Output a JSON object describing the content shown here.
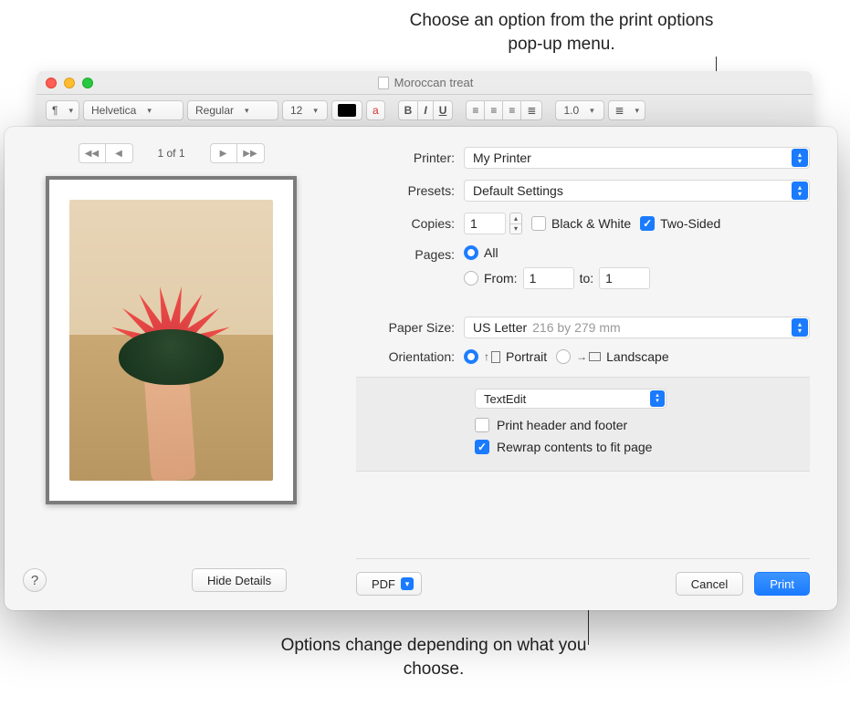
{
  "callouts": {
    "top": "Choose an option from the print options pop-up menu.",
    "bottom": "Options change depending on what you choose."
  },
  "editor": {
    "document_title": "Moroccan treat",
    "toolbar": {
      "paragraph": "¶",
      "font_family": "Helvetica",
      "font_style": "Regular",
      "font_size": "12",
      "color_icon": "a",
      "bold": "B",
      "italic": "I",
      "underline": "U",
      "line_spacing": "1.0"
    }
  },
  "print": {
    "pager": {
      "label": "1 of 1"
    },
    "printer": {
      "label": "Printer:",
      "value": "My Printer"
    },
    "presets": {
      "label": "Presets:",
      "value": "Default Settings"
    },
    "copies": {
      "label": "Copies:",
      "value": "1",
      "bw_label": "Black & White",
      "bw_on": false,
      "twosided_label": "Two-Sided",
      "twosided_on": true
    },
    "pages": {
      "label": "Pages:",
      "all_label": "All",
      "all_on": true,
      "from_label": "From:",
      "from_on": false,
      "from_value": "1",
      "to_label": "to:",
      "to_value": "1"
    },
    "paper_size": {
      "label": "Paper Size:",
      "value": "US Letter",
      "subtext": "216 by 279 mm"
    },
    "orientation": {
      "label": "Orientation:",
      "portrait_label": "Portrait",
      "portrait_on": true,
      "landscape_label": "Landscape",
      "landscape_on": false
    },
    "options_popup": "TextEdit",
    "header_footer": {
      "label": "Print header and footer",
      "on": false
    },
    "rewrap": {
      "label": "Rewrap contents to fit page",
      "on": true
    },
    "pdf_button": "PDF",
    "hide_details": "Hide Details",
    "cancel": "Cancel",
    "print_button": "Print"
  }
}
